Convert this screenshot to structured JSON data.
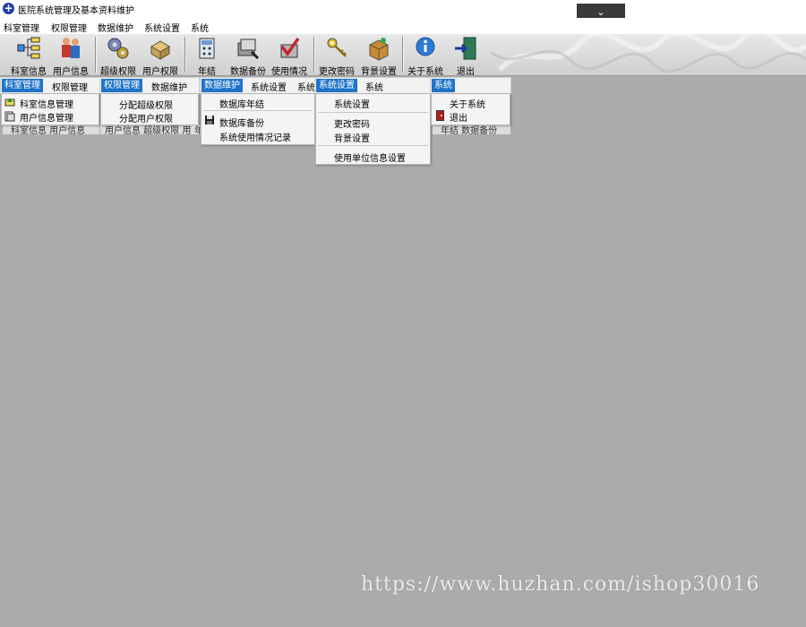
{
  "window": {
    "title": "医院系统管理及基本资料维护",
    "collapse_glyph": "⌄"
  },
  "menubar": [
    "科室管理",
    "权限管理",
    "数据维护",
    "系统设置",
    "系统"
  ],
  "toolbar": [
    "科室信息",
    "用户信息",
    "超级权限",
    "用户权限",
    "年结",
    "数据备份",
    "使用情况",
    "更改密码",
    "背景设置",
    "关于系统",
    "退出"
  ],
  "menus": {
    "dept": {
      "strip": [
        "科室管理",
        "权限管理"
      ],
      "items": [
        "科室信息管理",
        "用户信息管理"
      ],
      "under": "科室信息  用户信息"
    },
    "perm": {
      "strip": [
        "权限管理",
        "数据维护"
      ],
      "items": [
        "分配超级权限",
        "分配用户权限"
      ],
      "under": "用户信息   超级权限  用"
    },
    "data": {
      "strip": [
        "数据维护",
        "系统设置",
        "系统"
      ],
      "items": [
        "数据库年结",
        "数据库备份",
        "系统使用情况记录"
      ],
      "under": "年"
    },
    "settings": {
      "strip": [
        "系统设置",
        "系统"
      ],
      "items": [
        "系统设置",
        "更改密码",
        "背景设置",
        "使用单位信息设置"
      ]
    },
    "system": {
      "strip": [
        "系统"
      ],
      "items": [
        "关于系统",
        "退出"
      ],
      "under": "年结    数据备份"
    }
  },
  "watermark": "https://www.huzhan.com/ishop30016"
}
